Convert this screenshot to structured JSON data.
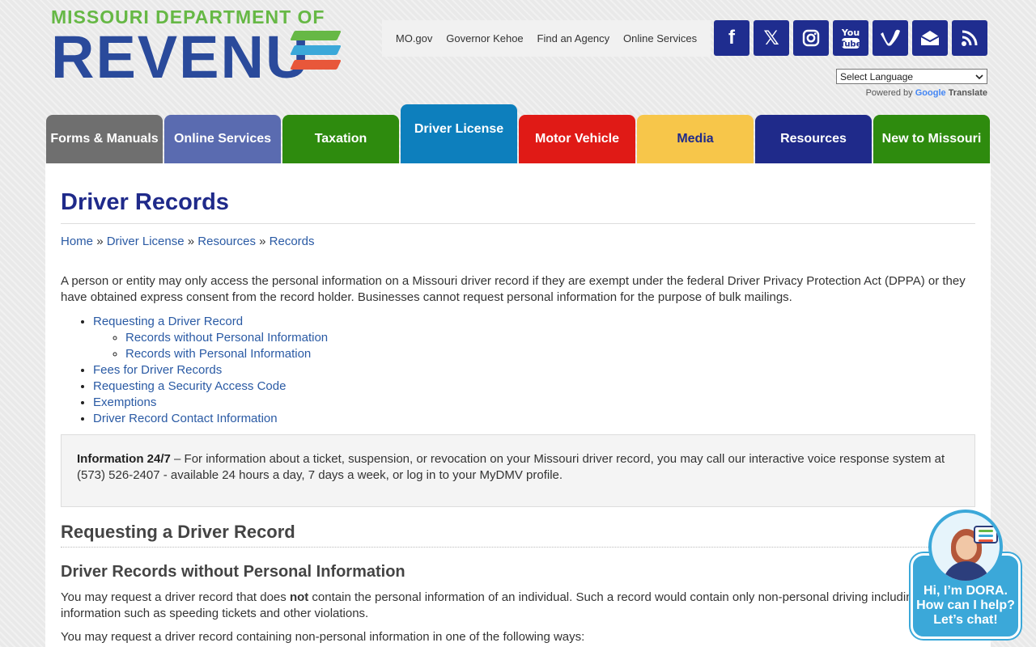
{
  "header": {
    "logo_top": "MISSOURI DEPARTMENT OF",
    "logo_main": "REVENU",
    "logo_stripe_colors": [
      "#66b845",
      "#3ba8d9",
      "#e8573a"
    ],
    "top_links": [
      "MO.gov",
      "Governor Kehoe",
      "Find an Agency",
      "Online Services"
    ],
    "social_icons": [
      "facebook-icon",
      "x-twitter-icon",
      "instagram-icon",
      "youtube-icon",
      "vimeo-icon",
      "email-icon",
      "rss-icon"
    ],
    "language_select": "Select Language",
    "powered_by": "Powered by",
    "google": "Google",
    "translate": "Translate"
  },
  "nav": {
    "tabs": [
      {
        "label": "Forms & Manuals",
        "color": "#6f6f6f"
      },
      {
        "label": "Online Services",
        "color": "#5a6bb0"
      },
      {
        "label": "Taxation",
        "color": "#2e8b0e"
      },
      {
        "label": "Driver License",
        "color": "#0d7fbd",
        "active": true
      },
      {
        "label": "Motor Vehicle",
        "color": "#e01a16"
      },
      {
        "label": "Media",
        "color": "#f7c64a",
        "text_color": "#1f2a8a"
      },
      {
        "label": "Resources",
        "color": "#1f2a8a"
      },
      {
        "label": "New to Missouri",
        "color": "#2e8b0e"
      }
    ]
  },
  "main": {
    "title": "Driver Records",
    "breadcrumb": [
      "Home",
      "Driver License",
      "Resources",
      "Records"
    ],
    "breadcrumb_sep": "»",
    "intro": "A person or entity may only access the personal information on a Missouri driver record if they are exempt under the federal Driver Privacy Protection Act (DPPA) or they have obtained express consent from the record holder.  Businesses cannot request personal information for the purpose of bulk mailings.",
    "toc": {
      "item1": "Requesting a Driver Record",
      "item1_sub1": "Records without Personal Information",
      "item1_sub2": "Records with Personal Information",
      "item2": "Fees for Driver Records",
      "item3": "Requesting a Security Access Code",
      "item4": "Exemptions",
      "item5": "Driver Record Contact Information"
    },
    "info_label": "Information 24/7",
    "info_text": " – For information about a ticket, suspension, or revocation on your Missouri driver record, you may call our interactive voice response system at (573) 526-2407 - available 24 hours a day, 7 days a week, or log in to your MyDMV profile.",
    "h2": "Requesting a Driver Record",
    "h3": "Driver Records without Personal Information",
    "p1_a": "You may request a driver record that does ",
    "p1_b": "not",
    "p1_c": " contain the personal information of an individual. Such a record would contain only non-personal driving including information such as speeding tickets and other violations.",
    "p2": "You may request a driver record containing non-personal information in one of the following ways:"
  },
  "chat": {
    "line1": "Hi, I’m DORA.",
    "line2": "How can I help?",
    "line3": "Let’s chat!"
  }
}
